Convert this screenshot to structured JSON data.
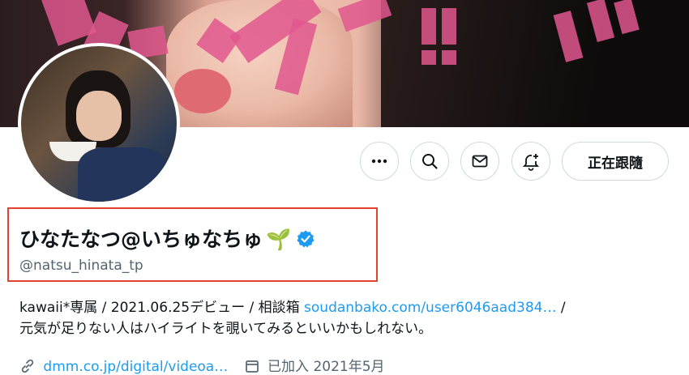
{
  "profile": {
    "display_name": "ひなたなつ@いちゅなちゅ",
    "name_emoji": "🌱",
    "handle": "@natsu_hinata_tp",
    "verified_icon": "verified-badge-icon",
    "bio_line1_text": "kawaii*専属 / 2021.06.25デビュー / 相談箱 ",
    "bio_link": "soudanbako.com/user6046aad384…",
    "bio_line1_tail": " /",
    "bio_line2": "元気が足りない人はハイライトを覗いてみるといいかもしれない。",
    "website": "dmm.co.jp/digital/videoa…",
    "joined": "已加入 2021年5月"
  },
  "actions": {
    "more_icon": "more-icon",
    "search_icon": "search-icon",
    "message_icon": "mail-icon",
    "notify_icon": "bell-plus-icon",
    "follow_label": "正在跟隨"
  },
  "colors": {
    "accent": "#1d9bf0",
    "highlight_border": "#e2432e",
    "banner_pink": "#e0578e"
  }
}
